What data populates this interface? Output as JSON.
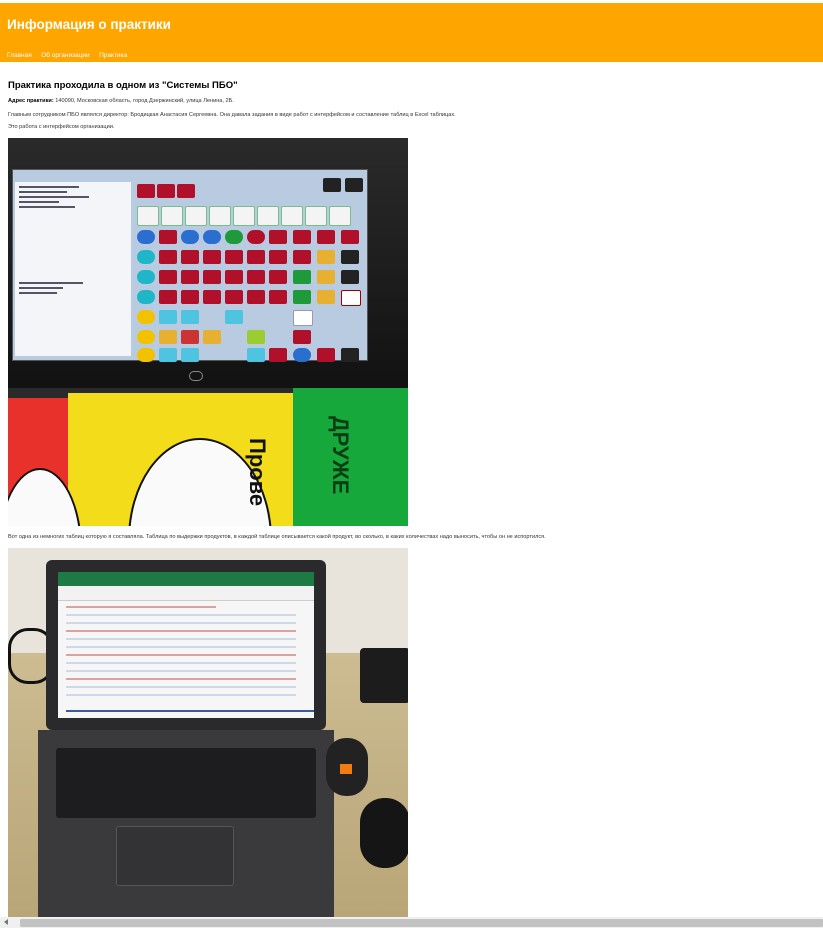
{
  "header": {
    "title": "Информация о практики",
    "nav": [
      {
        "label": "Главная"
      },
      {
        "label": "Об организации"
      },
      {
        "label": "Практика"
      }
    ],
    "color": "#ffa500"
  },
  "main": {
    "heading": "Практика проходила в одном из \"Системы ПБО\"",
    "address_label": "Адрес практики:",
    "address_value": "140090, Московская область, город Дзержинский, улица Ленина, 2Б.",
    "paragraph_1": "Главным сотрудником ПБО являлся директор: Бродицкая Анастасия Сергеевна. Она давала задания в виде работ с интерфейсом и составление таблиц в Excel таблицах.",
    "paragraph_2": "Это работа с интерфейсом организации.",
    "caption_2": "Вот одна из немногих таблиц которую я составляла. Таблица по выдержки продуктов, в каждой таблице описывается какой продукт, во сколько, в каких количествах надо выносить, чтобы он не испортился.",
    "photo_1_text": "Прове",
    "photo_1_text_2": "ДРУЖЕ"
  }
}
